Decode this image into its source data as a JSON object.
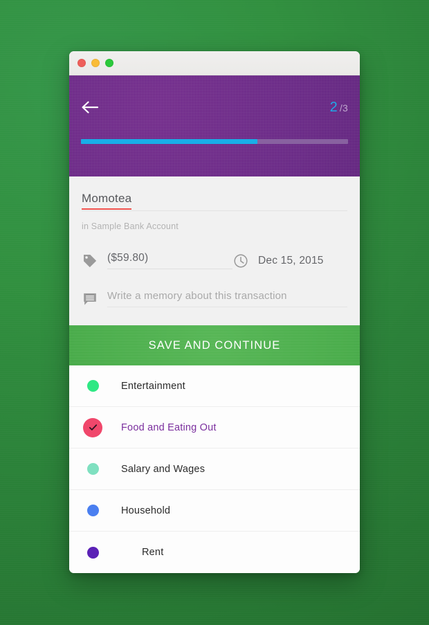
{
  "desktop": {
    "background_color": "#2d8a3e"
  },
  "window": {
    "traffic_lights": [
      {
        "name": "close",
        "color": "#ee5f5b"
      },
      {
        "name": "minimize",
        "color": "#f9bc38"
      },
      {
        "name": "zoom",
        "color": "#2bc93b"
      }
    ]
  },
  "header": {
    "background_color": "#6c2d88",
    "back_icon": "arrow-left-icon",
    "step_current": "2",
    "step_separator": "/",
    "step_total": "3",
    "step_current_color": "#1fa9e8",
    "progress_percent": 66,
    "progress_fill_color": "#19aee8",
    "progress_track_color": "#8861a0"
  },
  "detail": {
    "payee": "Momotea",
    "payee_underline_color": "#f2544f",
    "account": "in Sample Bank Account",
    "amount": {
      "icon": "price-tag-icon",
      "value": "($59.80)"
    },
    "date": {
      "icon": "clock-icon",
      "value": "Dec 15, 2015"
    },
    "memo": {
      "icon": "comment-icon",
      "placeholder": "Write a memory about this transaction",
      "value": "Write a memory about this transaction"
    }
  },
  "save_button": {
    "label": "SAVE AND CONTINUE",
    "color": "#4aac4b"
  },
  "categories": [
    {
      "label": "Entertainment",
      "color": "#2fe884",
      "selected": false,
      "indented": false
    },
    {
      "label": "Food and Eating Out",
      "color": "#f0476b",
      "selected": true,
      "indented": false
    },
    {
      "label": "Salary and Wages",
      "color": "#7fe0c0",
      "selected": false,
      "indented": false
    },
    {
      "label": "Household",
      "color": "#4a7ff0",
      "selected": false,
      "indented": false
    },
    {
      "label": "Rent",
      "color": "#5b21b6",
      "selected": false,
      "indented": true
    }
  ]
}
